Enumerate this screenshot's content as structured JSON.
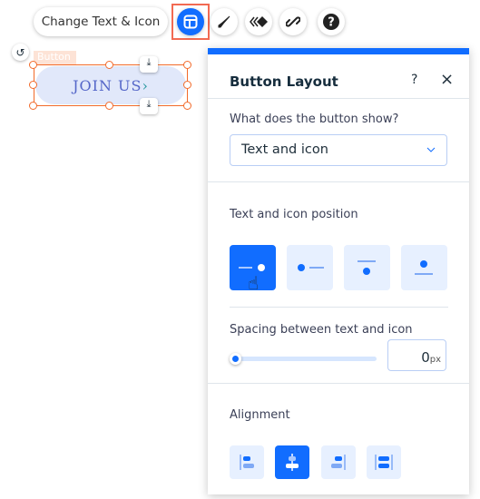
{
  "toolbar": {
    "change_text_label": "Change Text & Icon",
    "buttons": [
      "layout-icon",
      "brush-icon",
      "animation-icon",
      "link-icon",
      "help-icon"
    ]
  },
  "canvas": {
    "element_tag": "Button",
    "button_text": "JOIN US",
    "button_icon": "chevron-right-icon"
  },
  "panel": {
    "title": "Button Layout",
    "help": "?",
    "close": "×",
    "show_label": "What does the button show?",
    "show_value": "Text and icon",
    "position_label": "Text and icon position",
    "position_selected": 0,
    "spacing_label": "Spacing between text and icon",
    "spacing_value": "0",
    "spacing_unit": "px",
    "alignment_label": "Alignment",
    "alignment_selected": 1
  },
  "colors": {
    "accent": "#116dff",
    "selection": "#f26a2a"
  }
}
